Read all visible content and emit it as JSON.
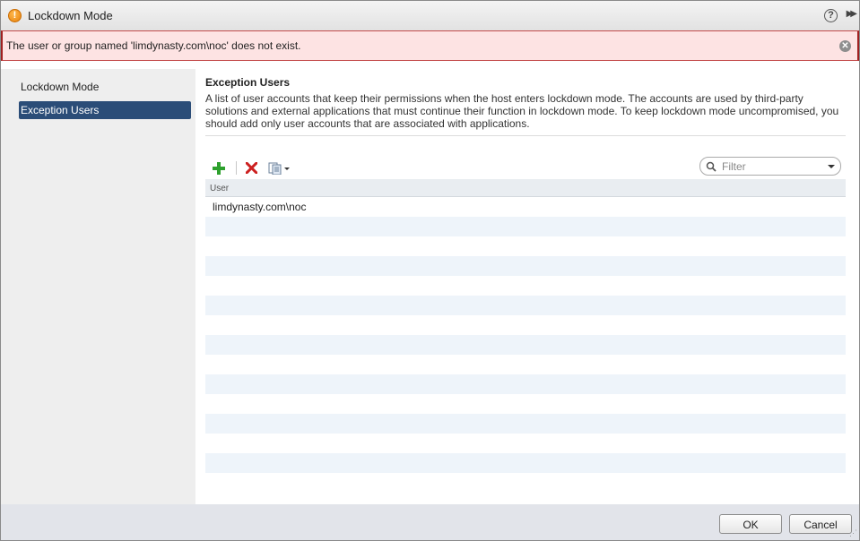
{
  "window": {
    "title": "Lockdown Mode",
    "help_glyph": "?",
    "expand_glyph": "▶▶"
  },
  "error": {
    "message": "The user or group named 'limdynasty.com\\noc' does not exist."
  },
  "sidebar": {
    "items": [
      {
        "label": "Lockdown Mode",
        "active": false
      },
      {
        "label": "Exception Users",
        "active": true
      }
    ]
  },
  "content": {
    "title": "Exception Users",
    "description": "A list of user accounts that keep their permissions when the host enters lockdown mode. The accounts are used by third-party solutions and external applications that must continue their function in lockdown mode. To keep lockdown mode uncompromised, you should add only user accounts that are associated with applications."
  },
  "toolbar": {
    "add_icon": "plus-icon",
    "remove_icon": "delete-x-icon",
    "export_icon": "export-copy-icon"
  },
  "filter": {
    "placeholder": "Filter"
  },
  "table": {
    "columns": [
      "User"
    ],
    "rows": [
      "limdynasty.com\\noc"
    ]
  },
  "footer": {
    "ok_label": "OK",
    "cancel_label": "Cancel"
  },
  "colors": {
    "accent": "#2b4d78",
    "error_bg": "#fde3e3",
    "error_border": "#a02020",
    "warning": "#e8820c",
    "add_green": "#2ea12e",
    "delete_red": "#cc2020"
  }
}
